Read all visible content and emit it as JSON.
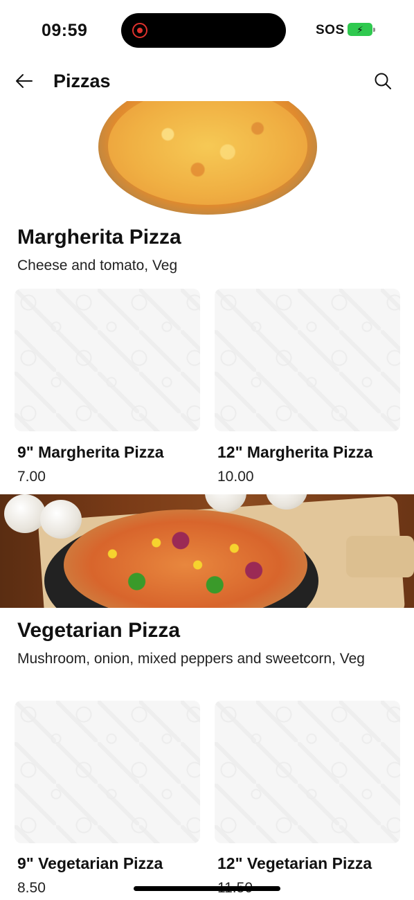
{
  "status_bar": {
    "time": "09:59",
    "carrier": "SOS",
    "battery_color": "#2fc94f",
    "recording_color": "#e0322d"
  },
  "header": {
    "title": "Pizzas",
    "back_icon": "arrow-left-icon",
    "search_icon": "search-icon"
  },
  "items": [
    {
      "name": "Margherita Pizza",
      "description": "Cheese and tomato, Veg",
      "variants": [
        {
          "label": "9\" Margherita Pizza",
          "price": "7.00"
        },
        {
          "label": "12\" Margherita Pizza",
          "price": "10.00"
        }
      ]
    },
    {
      "name": "Vegetarian Pizza",
      "description": "Mushroom, onion, mixed peppers and sweetcorn, Veg",
      "variants": [
        {
          "label": "9\" Vegetarian Pizza",
          "price": "8.50"
        },
        {
          "label": "12\" Vegetarian Pizza",
          "price": "11.50"
        }
      ]
    }
  ]
}
